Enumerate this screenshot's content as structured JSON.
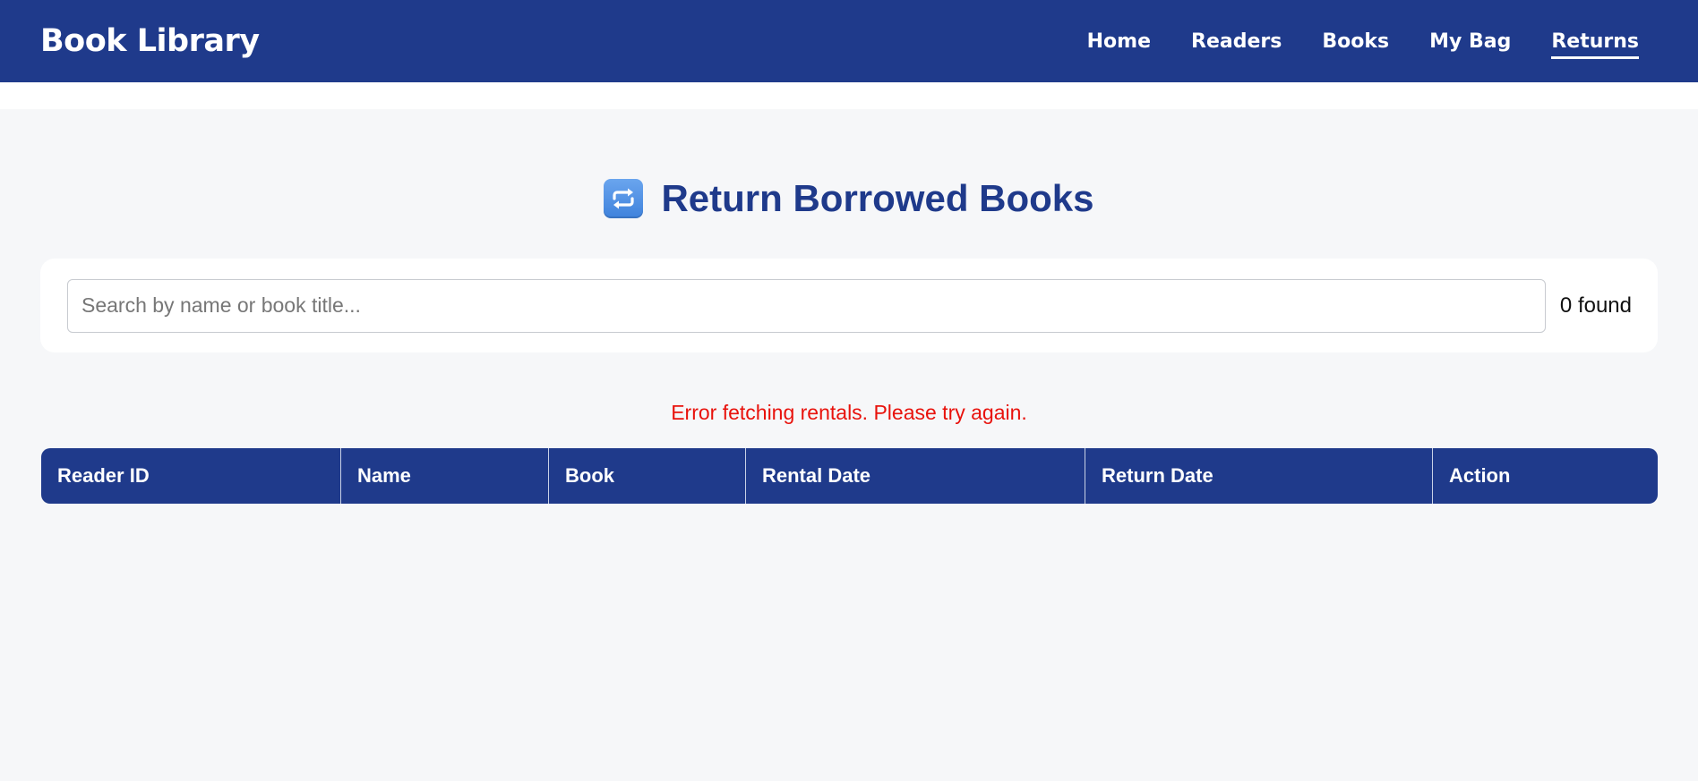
{
  "header": {
    "brand": "Book Library",
    "nav": [
      {
        "label": "Home"
      },
      {
        "label": "Readers"
      },
      {
        "label": "Books"
      },
      {
        "label": "My Bag"
      },
      {
        "label": "Returns"
      }
    ],
    "active": "Returns"
  },
  "page": {
    "icon": "repeat-icon",
    "title": "Return Borrowed Books"
  },
  "search": {
    "placeholder": "Search by name or book title...",
    "value": "",
    "count_text": "0 found"
  },
  "error": "Error fetching rentals. Please try again.",
  "table": {
    "columns": [
      "Reader ID",
      "Name",
      "Book",
      "Rental Date",
      "Return Date",
      "Action"
    ],
    "rows": []
  },
  "colors": {
    "primary": "#1f3a8b",
    "error": "#e8120c",
    "background": "#f6f7f9"
  }
}
